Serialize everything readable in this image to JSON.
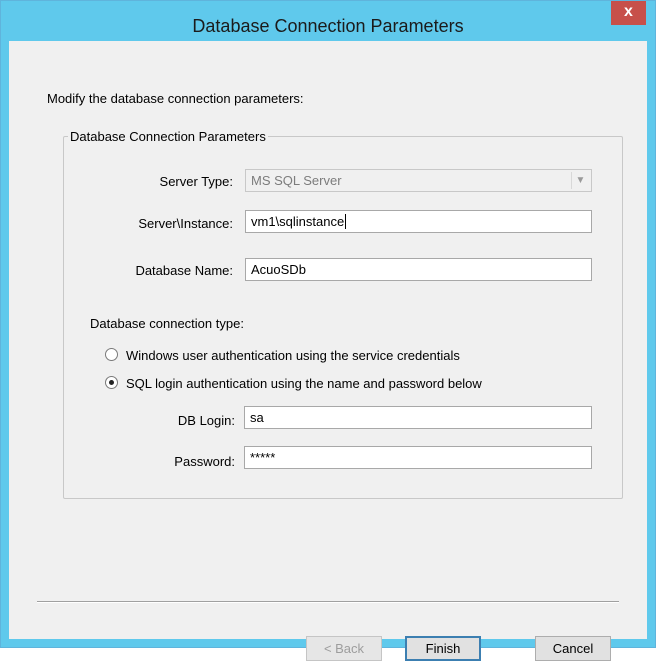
{
  "window": {
    "title": "Database Connection Parameters",
    "close_glyph": "x"
  },
  "intro_text": "Modify the database connection parameters:",
  "group": {
    "legend": "Database Connection Parameters",
    "server_type": {
      "label": "Server Type:",
      "value": "MS SQL Server"
    },
    "server_instance": {
      "label": "Server\\Instance:",
      "value": "vm1\\sqlinstance"
    },
    "database_name": {
      "label": "Database Name:",
      "value": "AcuoSDb"
    },
    "connection_type_label": "Database connection type:",
    "radio_windows": {
      "label": "Windows user authentication using the service credentials",
      "checked": false
    },
    "radio_sql": {
      "label": "SQL login authentication using the name and password below",
      "checked": true
    },
    "db_login": {
      "label": "DB Login:",
      "value": "sa"
    },
    "password": {
      "label": "Password:",
      "value": "*****"
    }
  },
  "buttons": {
    "back": "< Back",
    "finish": "Finish",
    "cancel": "Cancel"
  },
  "colors": {
    "title_bar": "#5fc9ec",
    "close_button": "#c7504a",
    "client_background": "#f0f0f0"
  }
}
